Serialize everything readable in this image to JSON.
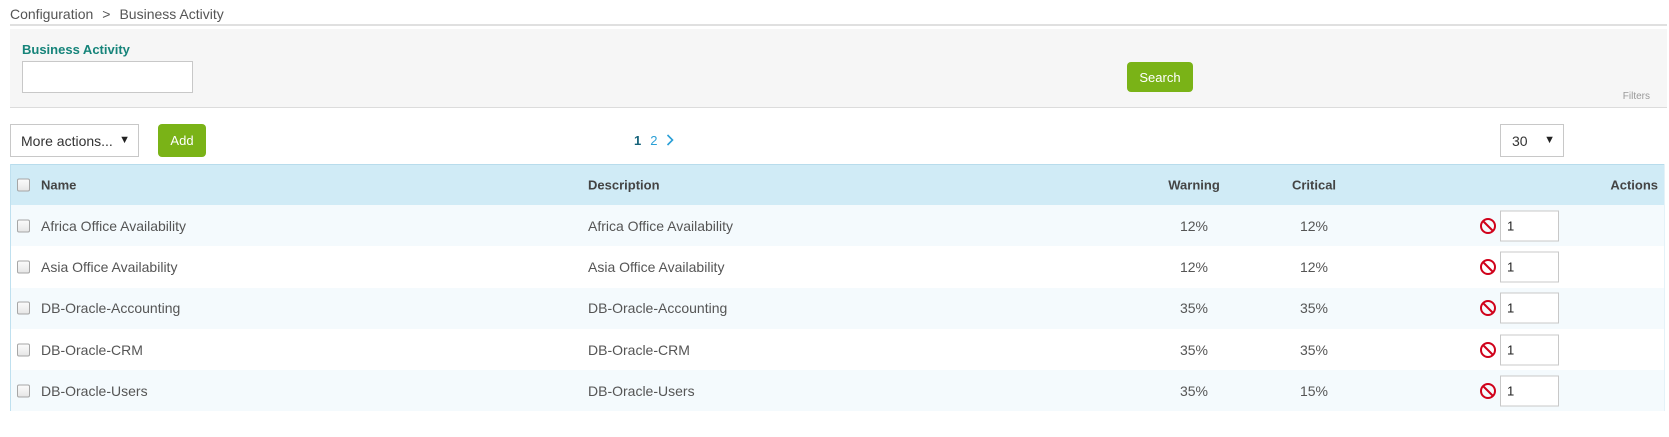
{
  "breadcrumb": {
    "items": [
      "Configuration",
      "Business Activity"
    ],
    "separator": ">"
  },
  "filters": {
    "business_activity_label": "Business Activity",
    "business_activity_value": "",
    "search_label": "Search",
    "panel_label": "Filters"
  },
  "toolbar": {
    "more_actions_label": "More actions...",
    "add_label": "Add",
    "pagination": {
      "current": "1",
      "pages": [
        "2"
      ]
    },
    "page_size": "30"
  },
  "table": {
    "columns": {
      "name": "Name",
      "description": "Description",
      "warning": "Warning",
      "critical": "Critical",
      "actions": "Actions"
    },
    "rows": [
      {
        "name": "Africa Office Availability",
        "description": "Africa Office Availability",
        "warning": "12%",
        "critical": "12%",
        "order": "1"
      },
      {
        "name": "Asia Office Availability",
        "description": "Asia Office Availability",
        "warning": "12%",
        "critical": "12%",
        "order": "1"
      },
      {
        "name": "DB-Oracle-Accounting",
        "description": "DB-Oracle-Accounting",
        "warning": "35%",
        "critical": "35%",
        "order": "1"
      },
      {
        "name": "DB-Oracle-CRM",
        "description": "DB-Oracle-CRM",
        "warning": "35%",
        "critical": "35%",
        "order": "1"
      },
      {
        "name": "DB-Oracle-Users",
        "description": "DB-Oracle-Users",
        "warning": "35%",
        "critical": "15%",
        "order": "1"
      }
    ]
  },
  "colors": {
    "accent_green": "#7ab317",
    "label_teal": "#16847a",
    "header_blue": "#d0ebf6",
    "link_blue": "#2a9fd6",
    "disable_red": "#d0021b"
  },
  "icons": {
    "row_action": "ban-icon",
    "next_page": "chevron-right-icon",
    "dropdown": "caret-down-icon"
  }
}
